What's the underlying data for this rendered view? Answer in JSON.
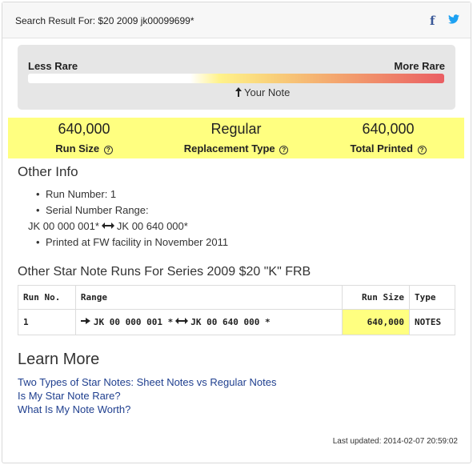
{
  "header": {
    "title": "Search Result For: $20 2009 jk00099699*",
    "facebook_icon": "facebook-icon",
    "twitter_icon": "twitter-icon"
  },
  "rarity": {
    "left_label": "Less Rare",
    "right_label": "More Rare",
    "marker_label": "Your Note",
    "marker_position_fraction": 0.52
  },
  "stats": [
    {
      "value": "640,000",
      "label": "Run Size"
    },
    {
      "value": "Regular",
      "label": "Replacement Type"
    },
    {
      "value": "640,000",
      "label": "Total Printed"
    }
  ],
  "other_info": {
    "heading": "Other Info",
    "items": [
      "Run Number: 1",
      "Serial Number Range:",
      "Printed at FW facility in November 2011"
    ],
    "serial_range": {
      "start": "JK 00 000 001*",
      "end": "JK 00 640 000*"
    }
  },
  "runs": {
    "heading": "Other Star Note Runs For Series 2009 $20 \"K\" FRB",
    "columns": [
      "Run No.",
      "Range",
      "Run Size",
      "Type"
    ],
    "rows": [
      {
        "run_no": "1",
        "range_start": "JK 00 000 001 *",
        "range_end": "JK 00 640 000 *",
        "run_size": "640,000",
        "type": "NOTES"
      }
    ]
  },
  "learn_more": {
    "heading": "Learn More",
    "links": [
      "Two Types of Star Notes: Sheet Notes vs Regular Notes",
      "Is My Star Note Rare?",
      "What Is My Note Worth?"
    ]
  },
  "footer": {
    "updated": "Last updated: 2014-02-07 20:59:02"
  },
  "colors": {
    "highlight": "#ffff80",
    "link": "#1f3f8f",
    "facebook": "#3b5998",
    "twitter": "#1da1f2",
    "gradient_end": "#ea5e63"
  }
}
